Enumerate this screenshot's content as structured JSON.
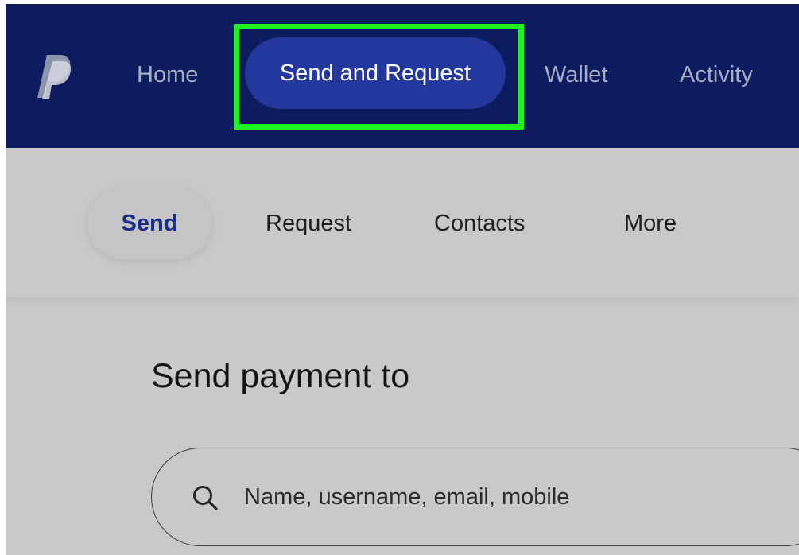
{
  "topnav": {
    "items": [
      {
        "label": "Home"
      },
      {
        "label": "Send and Request"
      },
      {
        "label": "Wallet"
      },
      {
        "label": "Activity"
      }
    ],
    "active_index": 1
  },
  "subnav": {
    "items": [
      {
        "label": "Send"
      },
      {
        "label": "Request"
      },
      {
        "label": "Contacts"
      },
      {
        "label": "More"
      }
    ],
    "active_index": 0
  },
  "main": {
    "title": "Send payment to",
    "search": {
      "value": "",
      "placeholder": "Name, username, email, mobile"
    }
  },
  "icons": {
    "logo": "paypal-logo-icon",
    "search": "search-icon"
  },
  "colors": {
    "nav_bg": "#0d1c5f",
    "nav_active_pill": "#23379d",
    "highlight_box": "#1ff21f",
    "active_sub_text": "#1a2d8a"
  }
}
